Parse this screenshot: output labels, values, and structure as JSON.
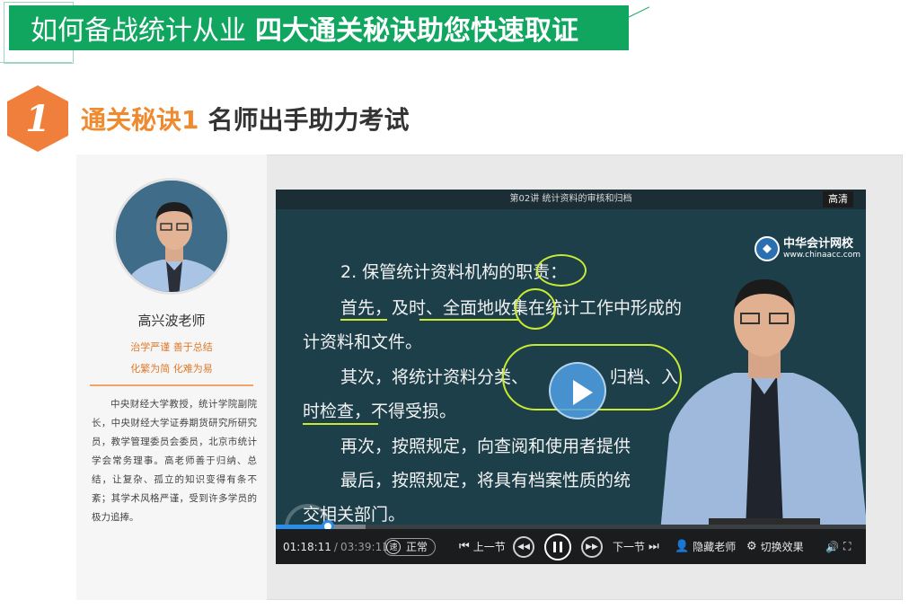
{
  "banner": {
    "title_normal": "如何备战统计从业",
    "title_bold": "四大通关秘诀助您快速取证"
  },
  "section": {
    "number": "1",
    "title_accent": "通关秘诀1",
    "title_rest": "名师出手助力考试"
  },
  "teacher": {
    "name": "高兴波老师",
    "motto_line1": "治学严谨  善于总结",
    "motto_line2": "化繁为简  化难为易",
    "bio": "中央财经大学教授，统计学院副院长，中央财经大学证券期货研究所研究员，教学管理委员会委员，北京市统计学会常务理事。高老师善于归纳、总结，让复杂、孤立的知识变得有条不紊；其学术风格严谨，受到许多学员的极力追捧。"
  },
  "video": {
    "lecture_title": "第02讲    统计资料的审核和归档",
    "quality_badge": "高清",
    "logo_name": "中华会计网校",
    "logo_url": "www.chinaacc.com",
    "slide_lines": [
      "2. 保管统计资料机构的职责：",
      "首先，及时、全面地收集在统计工作中形成的",
      "计资料和文件。",
      "其次，将统计资料分类、",
      "归档、入",
      "时检查，不得受损。",
      "再次，按照规定，向查阅和使用者提供",
      "最后，按照规定，将具有档案性质的统",
      "交相关部门。"
    ],
    "progress_fraction": 0.089,
    "buffered_fraction": 0.152,
    "current_time": "01:18:11",
    "time_separator": "/",
    "total_time": "03:39:11",
    "speed_icon_text": "速",
    "speed_label": "正常",
    "prev_label": "上一节",
    "next_label": "下一节",
    "hide_teacher_label": "隐藏老师",
    "switch_effect_label": "切换效果",
    "icons": {
      "prev": "skip-back-icon",
      "rewind": "rewind-icon",
      "pause": "pause-icon",
      "forward": "fast-forward-icon",
      "next": "skip-forward-icon",
      "teacher": "person-minus-icon",
      "effect": "gear-icon",
      "volume": "volume-icon",
      "fullscreen": "fullscreen-icon"
    }
  },
  "colors": {
    "banner_green": "#10a660",
    "accent_orange": "#f08a2e",
    "progress_blue": "#2a8ee8",
    "annotation_yellow": "#c9ea32"
  }
}
